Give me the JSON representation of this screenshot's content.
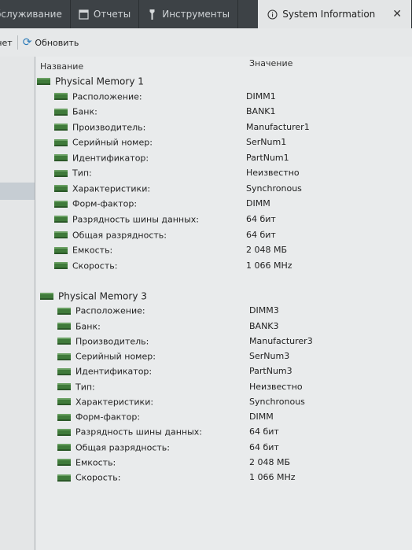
{
  "tabs": [
    {
      "label": "бслуживание",
      "icon": "document-icon"
    },
    {
      "label": "Отчеты",
      "icon": "reports-icon"
    },
    {
      "label": "Инструменты",
      "icon": "tools-icon"
    },
    {
      "label": "System Information",
      "icon": "info-icon",
      "active": true
    }
  ],
  "tab_close": "✕",
  "toolbar": {
    "left_label": "чет",
    "refresh_label": "Обновить"
  },
  "table": {
    "col_name": "Название",
    "col_value": "Значение",
    "groups": [
      {
        "title": "Physical Memory 1",
        "rows": [
          {
            "name": "Расположение:",
            "value": "DIMM1"
          },
          {
            "name": "Банк:",
            "value": "BANK1"
          },
          {
            "name": "Производитель:",
            "value": "Manufacturer1"
          },
          {
            "name": "Серийный номер:",
            "value": "SerNum1"
          },
          {
            "name": "Идентификатор:",
            "value": "PartNum1"
          },
          {
            "name": "Тип:",
            "value": "Неизвестно"
          },
          {
            "name": "Характеристики:",
            "value": "Synchronous"
          },
          {
            "name": "Форм-фактор:",
            "value": "DIMM"
          },
          {
            "name": "Разрядность шины данных:",
            "value": "64 бит"
          },
          {
            "name": "Общая разрядность:",
            "value": "64 бит"
          },
          {
            "name": "Емкость:",
            "value": "2 048 МБ"
          },
          {
            "name": "Скорость:",
            "value": "1 066 MHz"
          }
        ]
      },
      {
        "title": "Physical Memory 3",
        "rows": [
          {
            "name": "Расположение:",
            "value": "DIMM3"
          },
          {
            "name": "Банк:",
            "value": "BANK3"
          },
          {
            "name": "Производитель:",
            "value": "Manufacturer3"
          },
          {
            "name": "Серийный номер:",
            "value": "SerNum3"
          },
          {
            "name": "Идентификатор:",
            "value": "PartNum3"
          },
          {
            "name": "Тип:",
            "value": "Неизвестно"
          },
          {
            "name": "Характеристики:",
            "value": "Synchronous"
          },
          {
            "name": "Форм-фактор:",
            "value": "DIMM"
          },
          {
            "name": "Разрядность шины данных:",
            "value": "64 бит"
          },
          {
            "name": "Общая разрядность:",
            "value": "64 бит"
          },
          {
            "name": "Емкость:",
            "value": "2 048 МБ"
          },
          {
            "name": "Скорость:",
            "value": "1 066 MHz"
          }
        ]
      }
    ]
  }
}
